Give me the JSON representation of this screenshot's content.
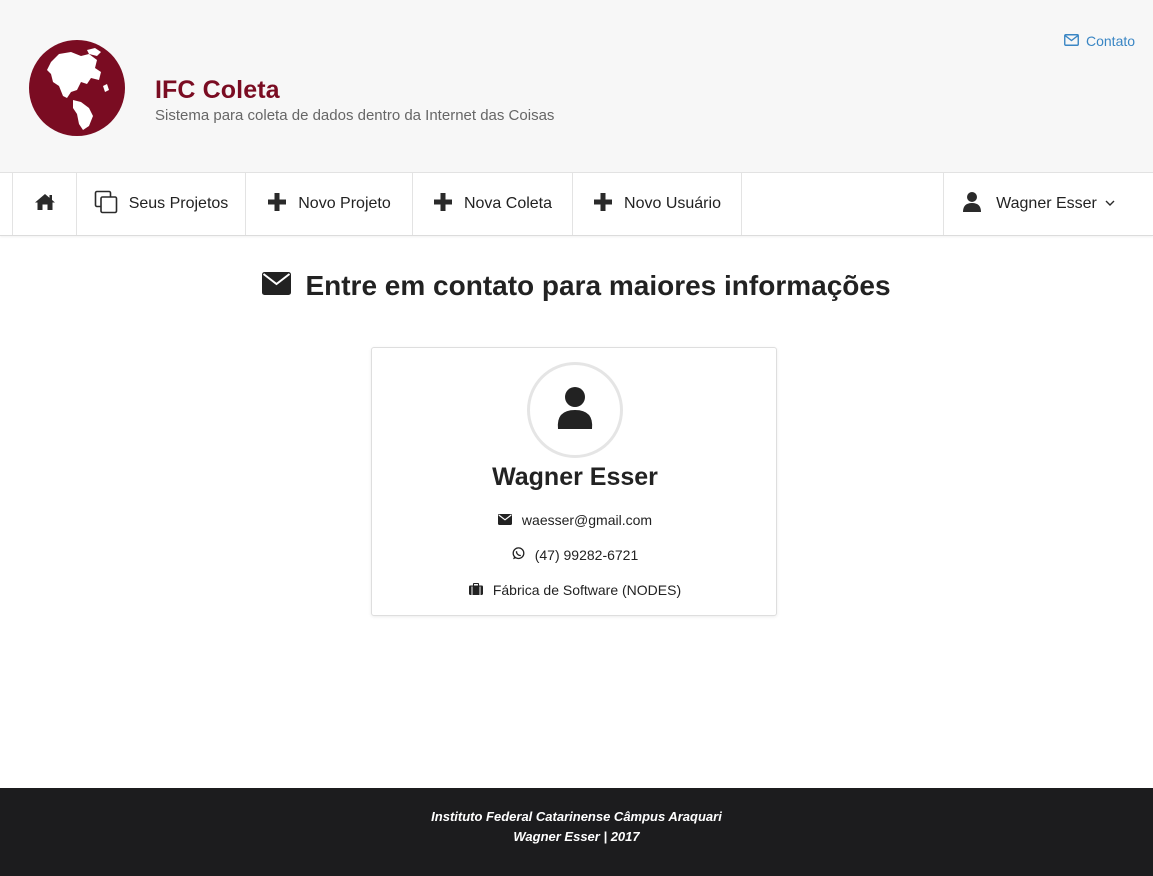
{
  "header": {
    "title": "IFC Coleta",
    "subtitle": "Sistema para coleta de dados dentro da Internet das Coisas",
    "contact_label": "Contato"
  },
  "nav": {
    "items": [
      {
        "label": "Seus Projetos",
        "icon": "copy-icon"
      },
      {
        "label": "Novo Projeto",
        "icon": "plus-icon"
      },
      {
        "label": "Nova Coleta",
        "icon": "plus-icon"
      },
      {
        "label": "Novo Usuário",
        "icon": "plus-icon"
      }
    ],
    "user": {
      "label": "Wagner Esser",
      "icon": "user-icon"
    }
  },
  "main": {
    "title": "Entre em contato para maiores informações",
    "card": {
      "name": "Wagner Esser",
      "email": "waesser@gmail.com",
      "phone": "(47) 99282-6721",
      "org": "Fábrica de Software (NODES)"
    }
  },
  "footer": {
    "line1": "Instituto Federal Catarinense Câmpus Araquari",
    "line2": "Wagner Esser | 2017"
  },
  "colors": {
    "brand": "#7a0c22",
    "link": "#3a86c4",
    "footer_bg": "#1c1c1e"
  }
}
